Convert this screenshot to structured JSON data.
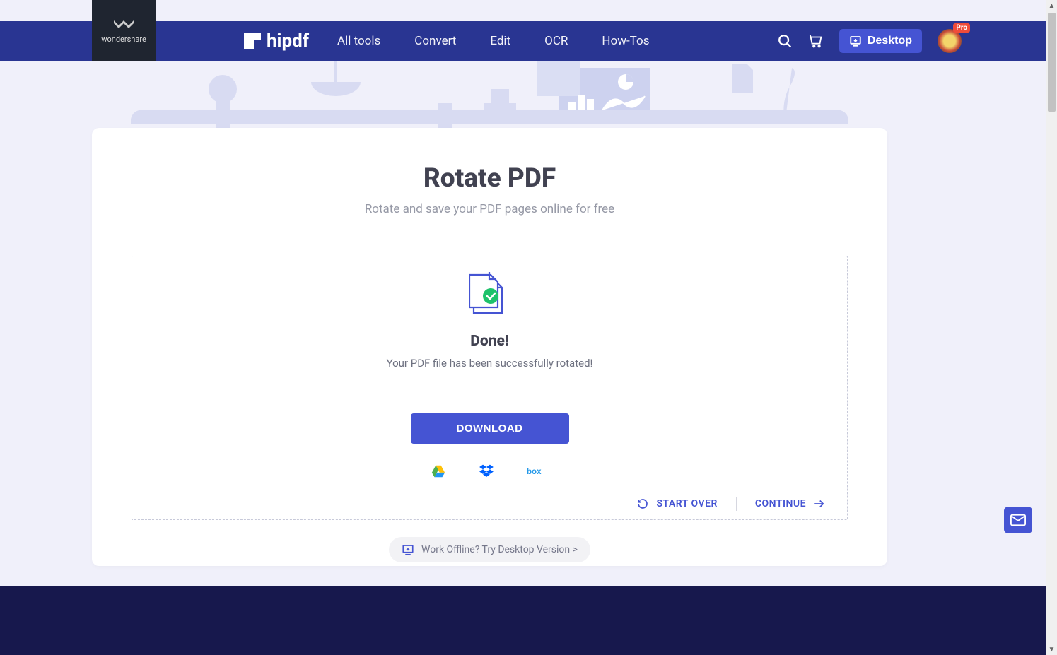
{
  "brand": {
    "parent": "wondershare",
    "product": "hipdf"
  },
  "nav": {
    "all_tools": "All tools",
    "convert": "Convert",
    "edit": "Edit",
    "ocr": "OCR",
    "how_tos": "How-Tos"
  },
  "header": {
    "desktop_label": "Desktop",
    "avatar_badge": "Pro"
  },
  "page": {
    "title": "Rotate PDF",
    "subtitle": "Rotate and save your PDF pages online for free"
  },
  "result": {
    "done_title": "Done!",
    "done_subtitle": "Your PDF file has been successfully rotated!",
    "download_label": "DOWNLOAD",
    "start_over": "START OVER",
    "continue": "CONTINUE"
  },
  "cloud": {
    "gdrive": "google-drive",
    "dropbox": "dropbox",
    "box": "box"
  },
  "offline": {
    "label": "Work Offline? Try Desktop Version >"
  }
}
